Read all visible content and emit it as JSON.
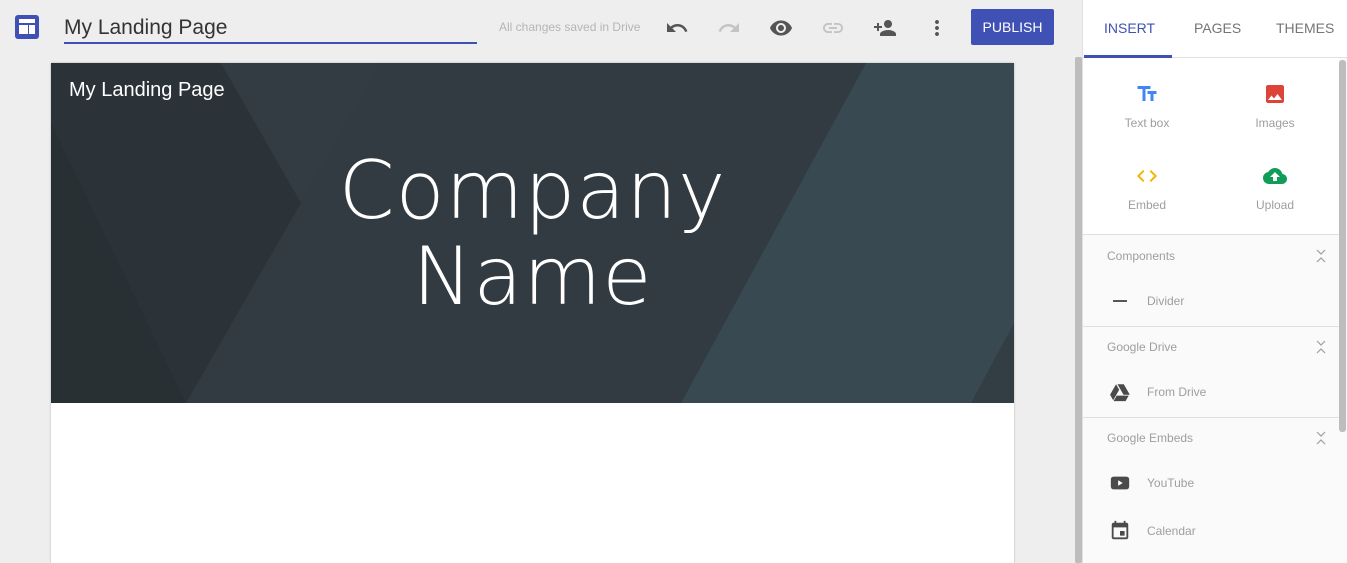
{
  "topbar": {
    "logo_icon": "sites-layout-icon",
    "title_value": "My Landing Page",
    "save_status": "All changes saved in Drive",
    "actions": [
      {
        "name": "undo",
        "icon": "undo-icon",
        "enabled": true
      },
      {
        "name": "redo",
        "icon": "redo-icon",
        "enabled": false
      },
      {
        "name": "preview",
        "icon": "eye-icon",
        "enabled": true
      },
      {
        "name": "copy-link",
        "icon": "link-icon",
        "enabled": false
      },
      {
        "name": "share",
        "icon": "add-person-icon",
        "enabled": true
      },
      {
        "name": "more",
        "icon": "more-vert-icon",
        "enabled": true
      }
    ],
    "publish_label": "PUBLISH"
  },
  "page": {
    "site_title": "My Landing Page",
    "hero_line1": "Company",
    "hero_line2": "Name"
  },
  "panel": {
    "tabs": [
      {
        "label": "INSERT",
        "active": true
      },
      {
        "label": "PAGES",
        "active": false
      },
      {
        "label": "THEMES",
        "active": false
      }
    ],
    "insert_items": [
      {
        "label": "Text box",
        "icon": "text-box-icon",
        "color": "#4285f4"
      },
      {
        "label": "Images",
        "icon": "image-icon",
        "color": "#db4437"
      },
      {
        "label": "Embed",
        "icon": "embed-code-icon",
        "color": "#f4b400"
      },
      {
        "label": "Upload",
        "icon": "cloud-upload-icon",
        "color": "#0f9d58"
      }
    ],
    "sections": [
      {
        "title": "Components",
        "items": [
          {
            "label": "Divider",
            "icon": "divider-icon"
          }
        ]
      },
      {
        "title": "Google Drive",
        "items": [
          {
            "label": "From Drive",
            "icon": "google-drive-icon"
          }
        ]
      },
      {
        "title": "Google Embeds",
        "items": [
          {
            "label": "YouTube",
            "icon": "youtube-icon"
          },
          {
            "label": "Calendar",
            "icon": "calendar-icon"
          }
        ]
      }
    ]
  },
  "colors": {
    "accent": "#3f51b5",
    "hero_bg": "#2c3338"
  }
}
